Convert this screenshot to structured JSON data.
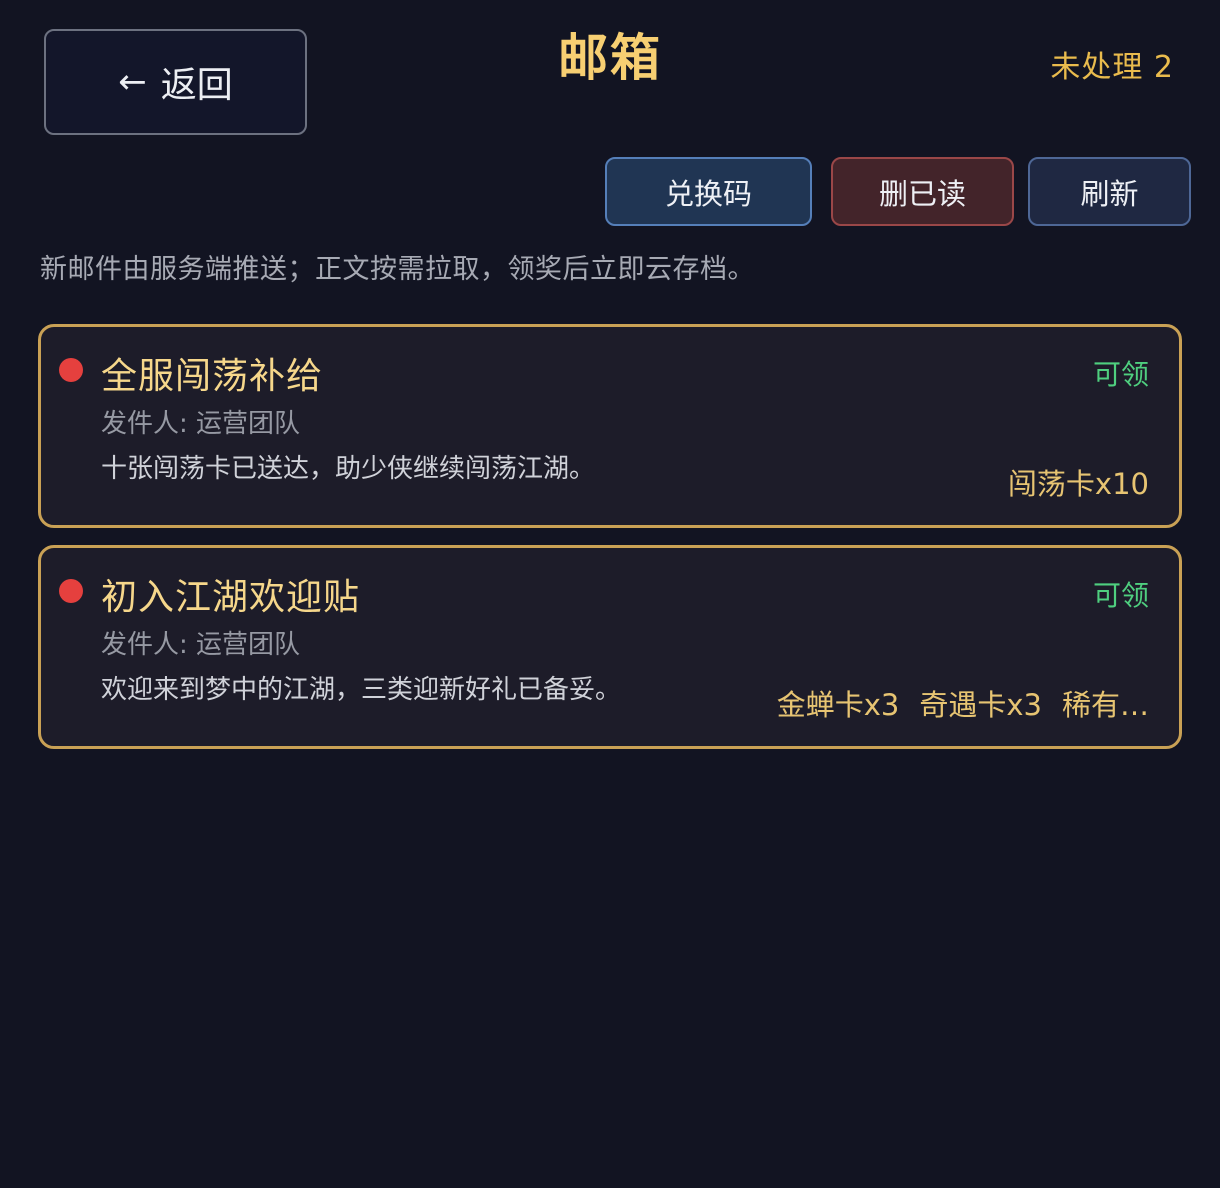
{
  "header": {
    "back_label": "返回",
    "title": "邮箱",
    "pending": "未处理 2"
  },
  "toolbar": {
    "redeem_label": "兑换码",
    "delete_read_label": "删已读",
    "refresh_label": "刷新"
  },
  "notice": "新邮件由服务端推送；正文按需拉取，领奖后立即云存档。",
  "mails": [
    {
      "title": "全服闯荡补给",
      "sender": "发件人: 运营团队",
      "body": "十张闯荡卡已送达，助少侠继续闯荡江湖。",
      "status": "可领",
      "rewards": [
        "闯荡卡x10"
      ]
    },
    {
      "title": "初入江湖欢迎贴",
      "sender": "发件人: 运营团队",
      "body": "欢迎来到梦中的江湖，三类迎新好礼已备妥。",
      "status": "可领",
      "rewards": [
        "金蝉卡x3",
        "奇遇卡x3",
        "稀有…"
      ]
    }
  ],
  "colors": {
    "background": "#121422",
    "accent_gold": "#f7cf72",
    "status_green": "#4fcf7f",
    "unread_dot": "#e5403e",
    "card_border": "#c9a155"
  },
  "icons": {
    "back": "arrow-left-icon",
    "unread": "unread-dot-icon"
  }
}
